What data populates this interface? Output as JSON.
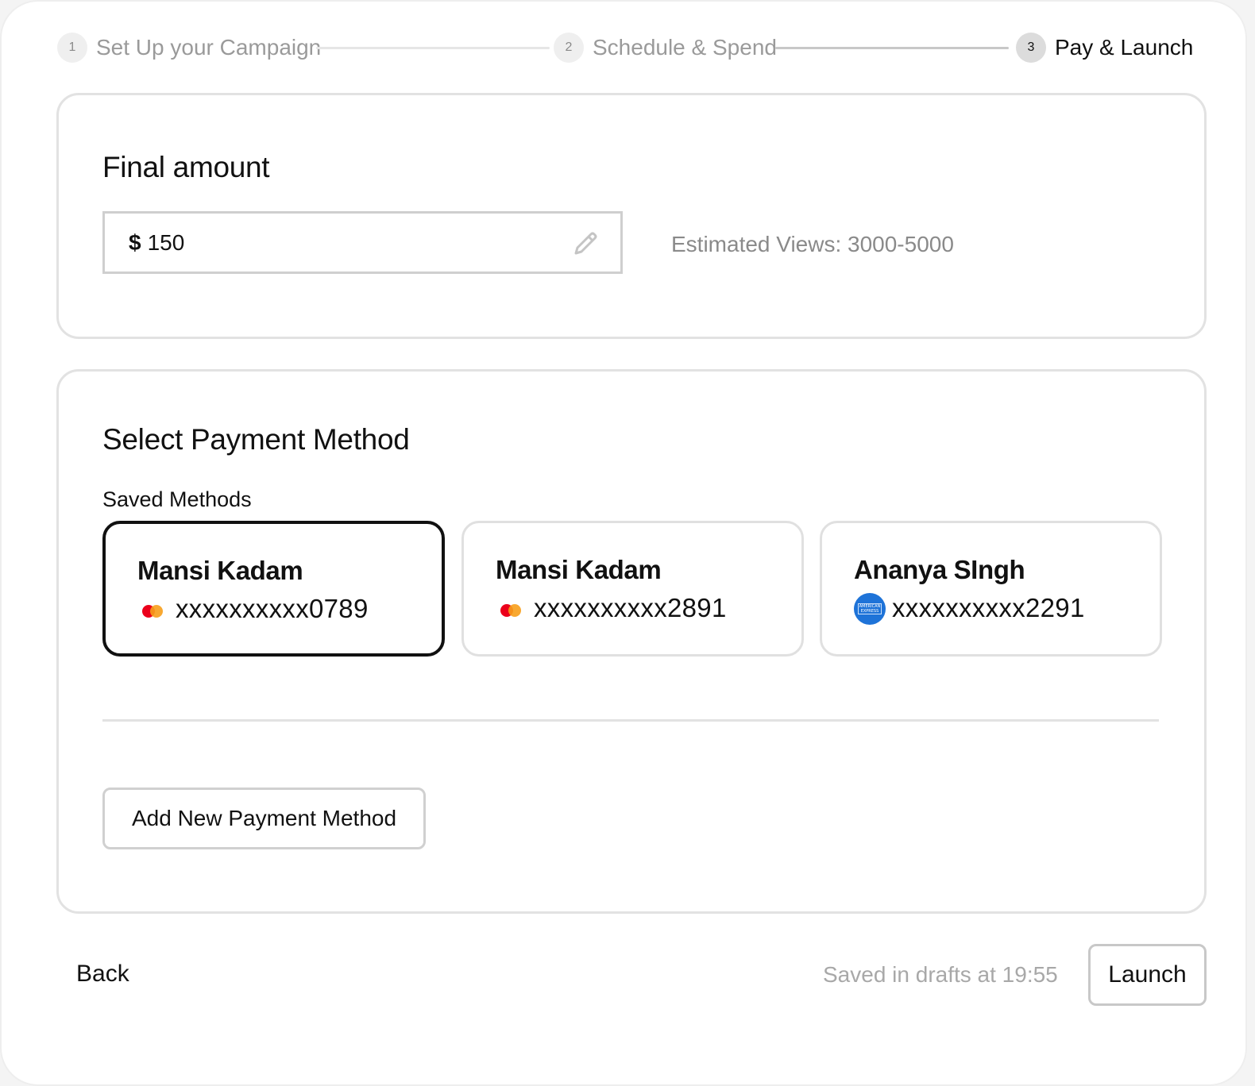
{
  "stepper": {
    "steps": [
      {
        "number": "1",
        "label": "Set Up your Campaign"
      },
      {
        "number": "2",
        "label": "Schedule & Spend"
      },
      {
        "number": "3",
        "label": "Pay & Launch"
      }
    ]
  },
  "final_amount": {
    "title": "Final amount",
    "currency": "$",
    "value": "150",
    "estimate": "Estimated Views: 3000-5000"
  },
  "payment": {
    "title": "Select Payment Method",
    "saved_label": "Saved Methods",
    "methods": [
      {
        "name": "Mansi Kadam",
        "number": "xxxxxxxxxx0789",
        "brand_icon": "mastercard-icon",
        "selected": true
      },
      {
        "name": "Mansi Kadam",
        "number": "xxxxxxxxxx2891",
        "brand_icon": "mastercard-icon",
        "selected": false
      },
      {
        "name": "Ananya SIngh",
        "number": "xxxxxxxxxx2291",
        "brand_icon": "amex-icon",
        "selected": false
      }
    ],
    "add_label": "Add New Payment Method"
  },
  "footer": {
    "back_label": "Back",
    "saved_status": "Saved in drafts at 19:55",
    "launch_label": "Launch"
  },
  "colors": {
    "mastercard_red": "#eb001b",
    "mastercard_orange": "#f79e1b",
    "amex_blue": "#1e73d8"
  }
}
